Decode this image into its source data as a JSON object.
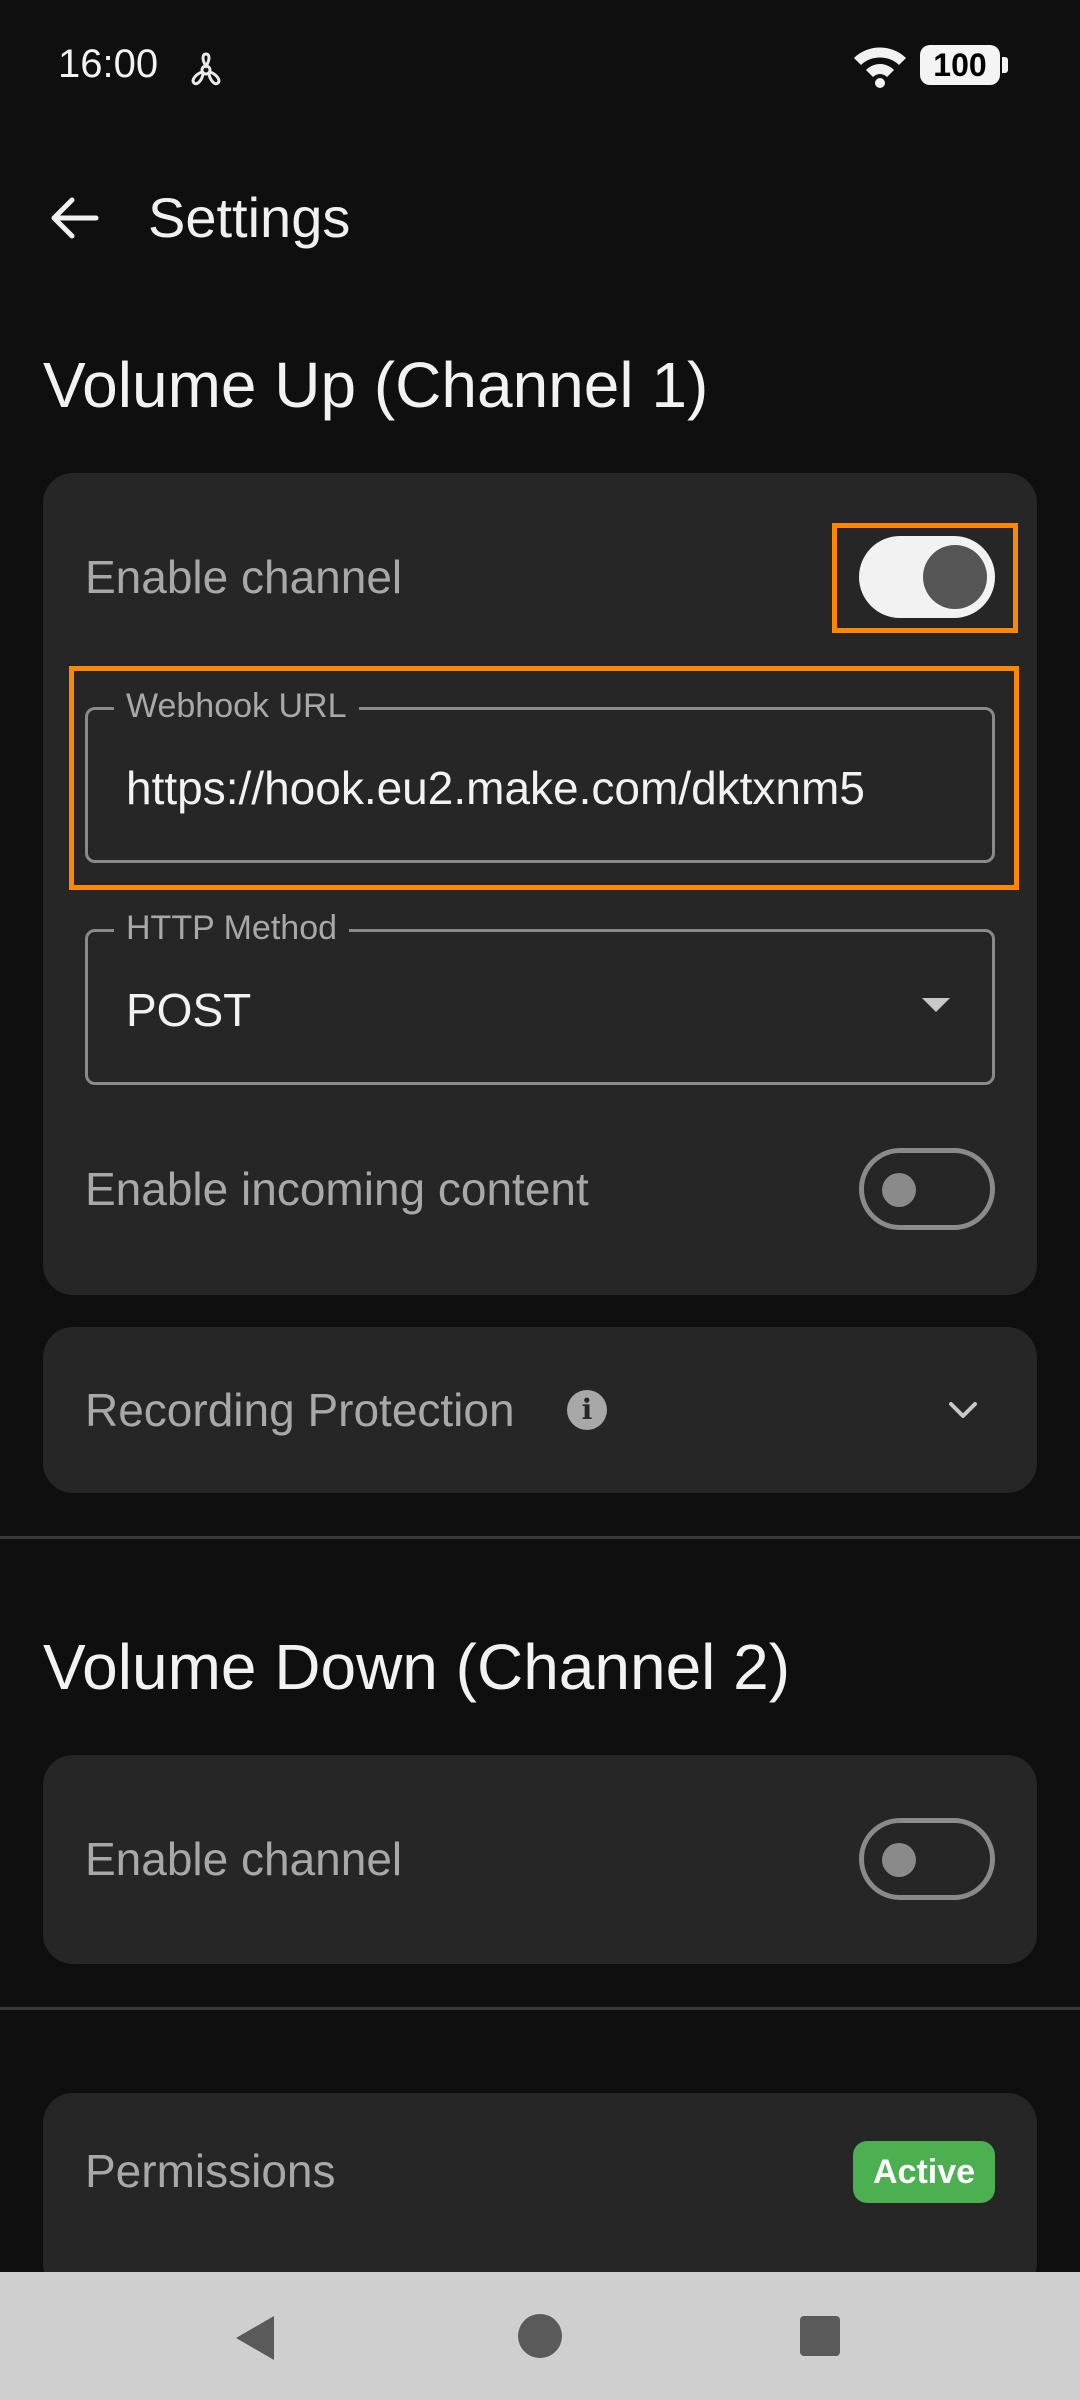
{
  "status_bar": {
    "time": "16:00",
    "notification_icon": "fan-icon",
    "wifi_icon": "wifi-icon",
    "battery_level": "100"
  },
  "app_bar": {
    "back_icon": "arrow-back-icon",
    "title": "Settings"
  },
  "channel1": {
    "title": "Volume Up (Channel 1)",
    "enable_label": "Enable channel",
    "enabled": true,
    "webhook_label": "Webhook URL",
    "webhook_value": "https://hook.eu2.make.com/dktxnm5",
    "method_label": "HTTP Method",
    "method_value": "POST",
    "incoming_label": "Enable incoming content",
    "incoming_enabled": false,
    "recording_label": "Recording Protection",
    "recording_info_icon": "info-icon",
    "recording_chevron": "chevron-down-icon"
  },
  "channel2": {
    "title": "Volume Down (Channel 2)",
    "enable_label": "Enable channel",
    "enabled": false
  },
  "permissions": {
    "title": "Permissions",
    "status": "Active",
    "status_color": "#4caf50"
  },
  "highlight_color": "#ff8800",
  "nav_bar": {
    "back_icon": "nav-back-icon",
    "home_icon": "nav-home-icon",
    "recents_icon": "nav-recents-icon"
  }
}
